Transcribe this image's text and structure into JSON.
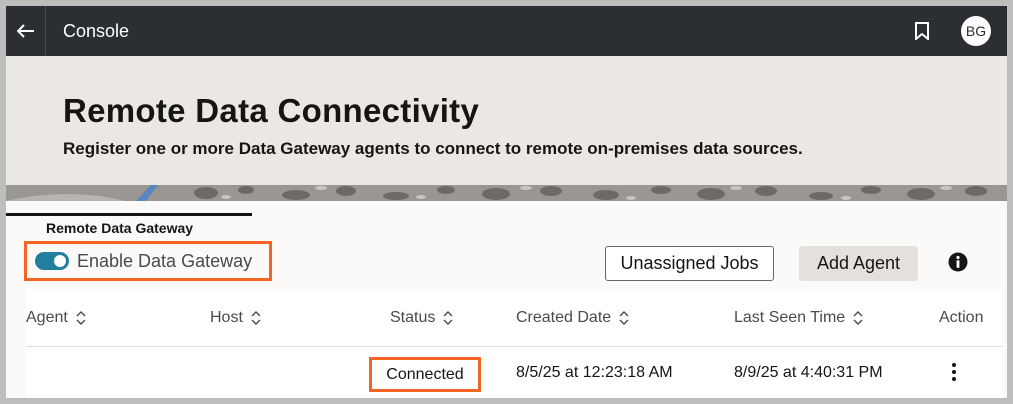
{
  "topbar": {
    "back_icon": "arrow-left-icon",
    "title": "Console",
    "bookmark_icon": "bookmark-icon",
    "avatar_initials": "BG"
  },
  "header": {
    "title": "Remote Data Connectivity",
    "subtitle": "Register one or more Data Gateway agents to connect to remote on-premises data sources."
  },
  "tabs": [
    {
      "label": "Remote Data Gateway",
      "active": true
    }
  ],
  "toolbar": {
    "toggle_label": "Enable Data Gateway",
    "toggle_on": true,
    "unassigned_jobs_label": "Unassigned Jobs",
    "add_agent_label": "Add Agent",
    "info_icon": "info-icon"
  },
  "table": {
    "columns": [
      "Agent",
      "Host",
      "Status",
      "Created Date",
      "Last Seen Time",
      "Action"
    ],
    "rows": [
      {
        "agent": "",
        "host": "",
        "status": "Connected",
        "created": "8/5/25 at 12:23:18 AM",
        "last_seen": "8/9/25 at 4:40:31 PM",
        "action_icon": "more-vertical-icon"
      }
    ]
  },
  "colors": {
    "topbar": "#2b2f33",
    "header": "#ebe8e4",
    "highlight": "#f26522",
    "toggle": "#227e9e"
  }
}
